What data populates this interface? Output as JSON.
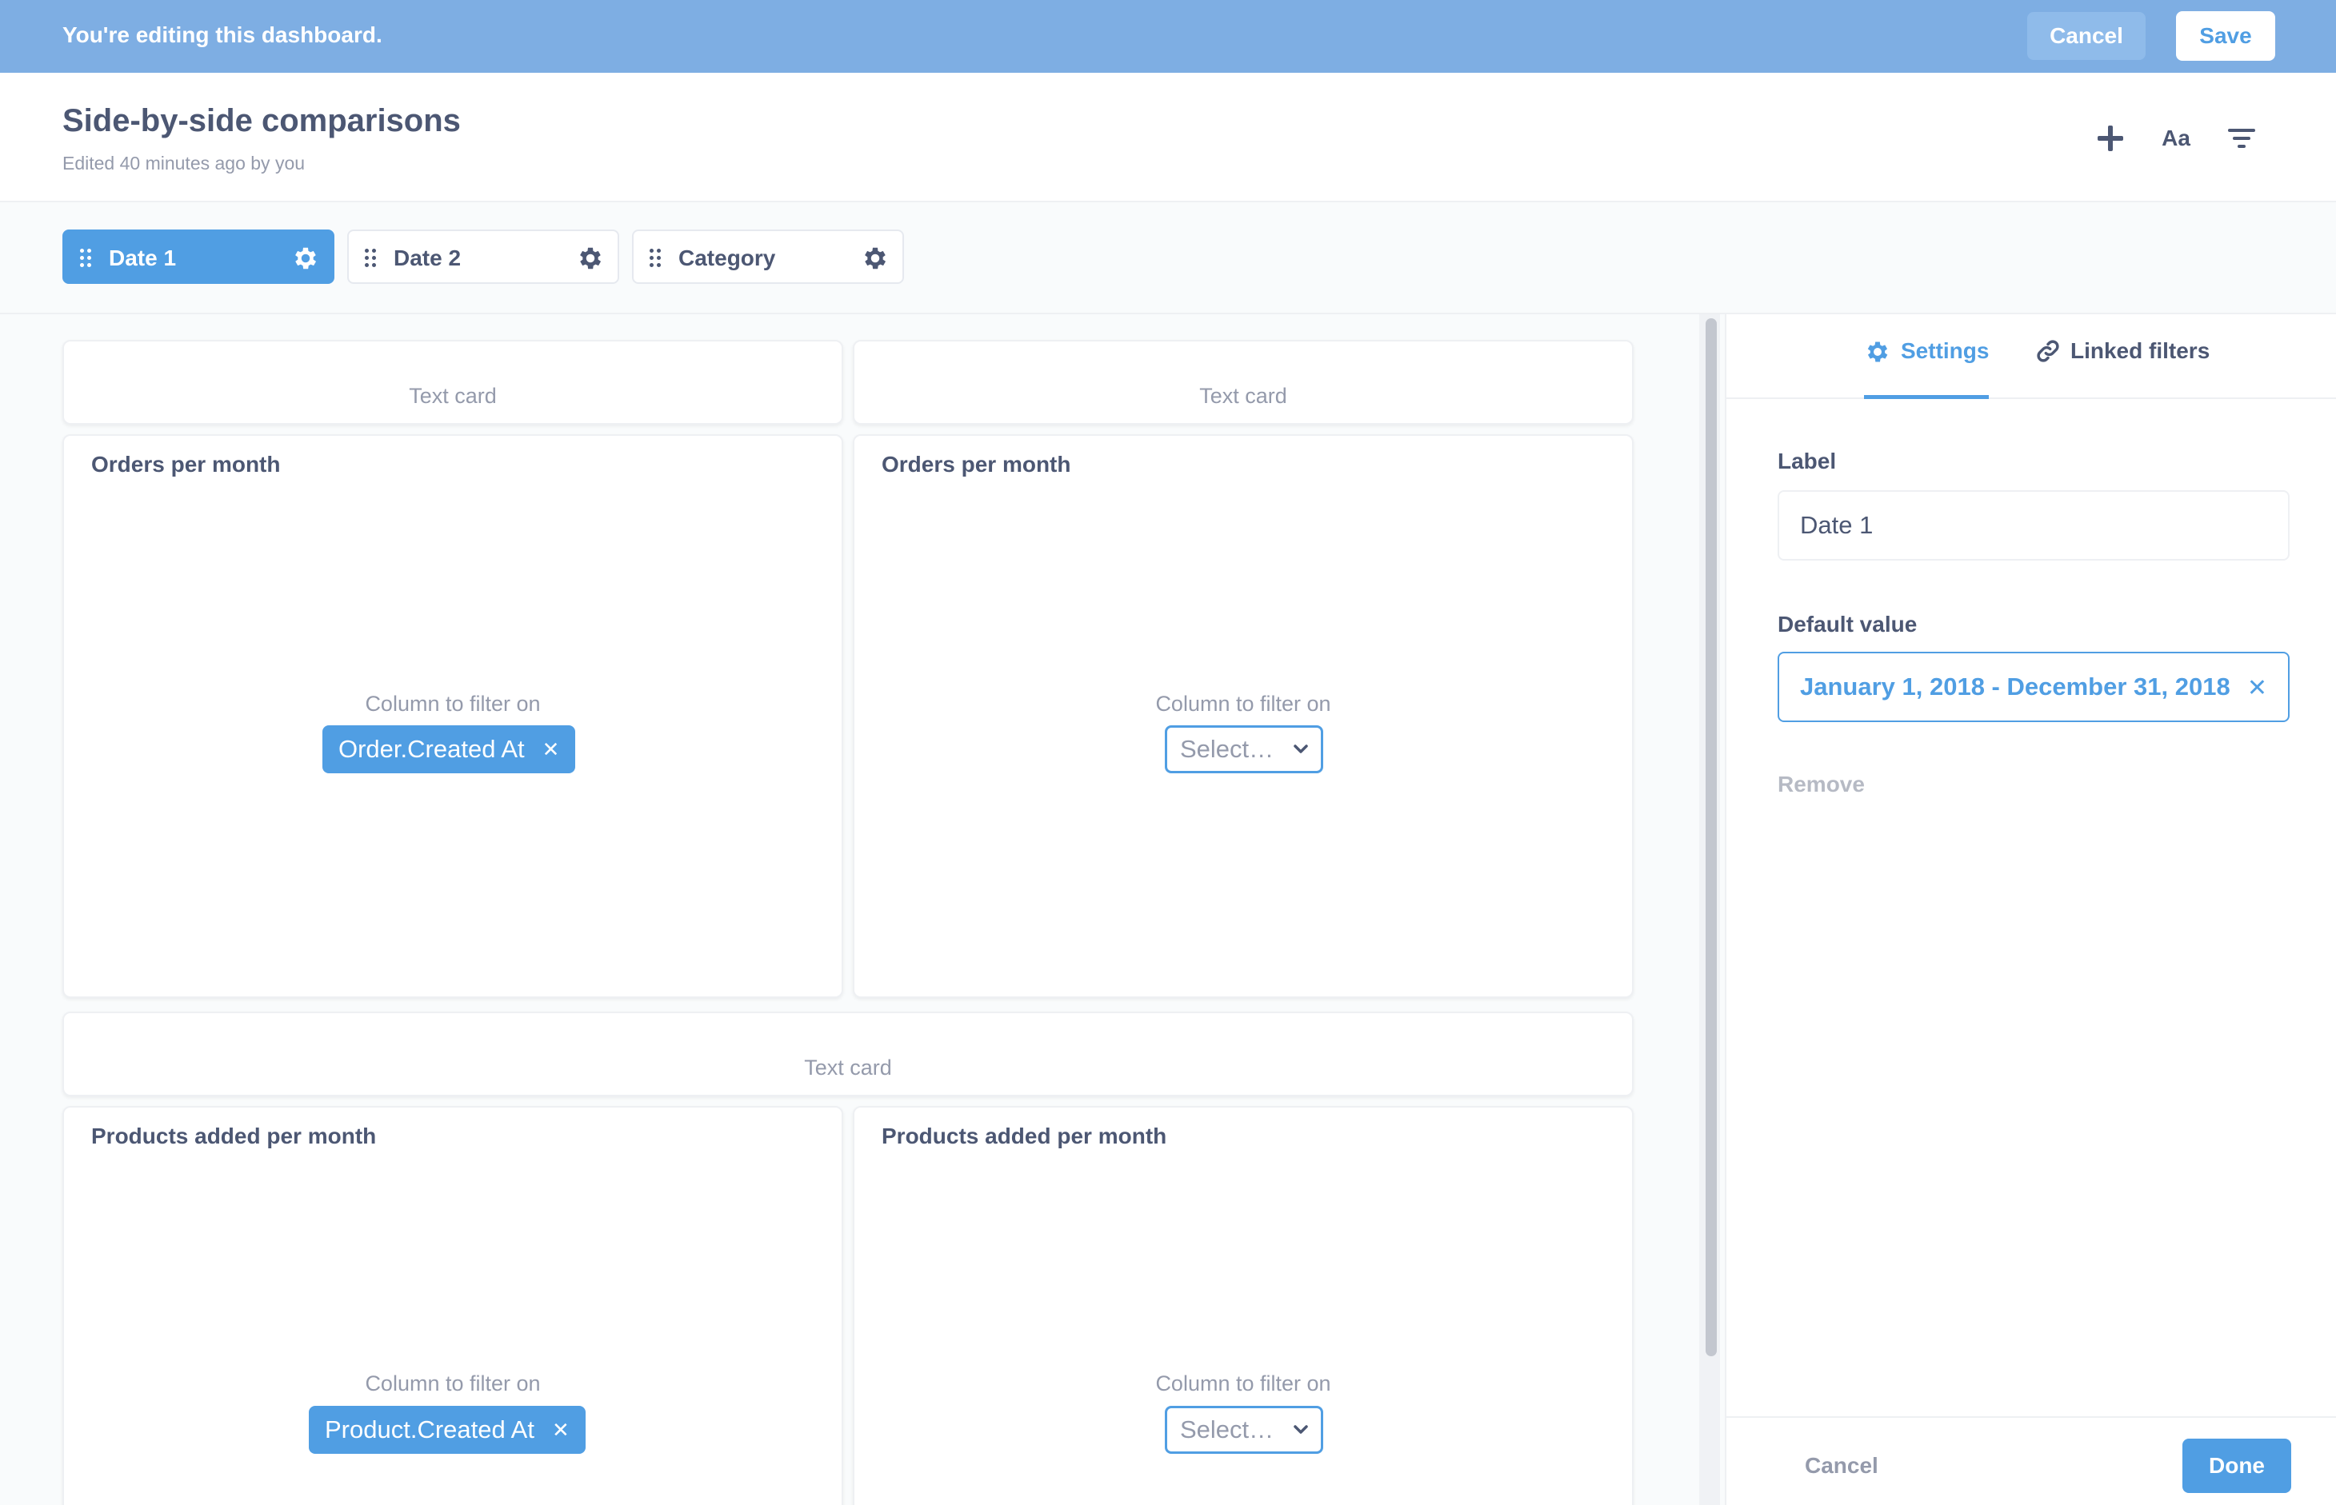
{
  "edit_bar": {
    "message": "You're editing this dashboard.",
    "cancel_label": "Cancel",
    "save_label": "Save"
  },
  "header": {
    "title": "Side-by-side comparisons",
    "subtitle": "Edited 40 minutes ago by you",
    "icons": [
      "add-icon",
      "text-format-icon",
      "filter-icon"
    ],
    "text_icon_label": "Aa"
  },
  "filters": [
    {
      "label": "Date 1",
      "active": true
    },
    {
      "label": "Date 2",
      "active": false
    },
    {
      "label": "Category",
      "active": false
    }
  ],
  "cards": {
    "text_card_label": "Text card",
    "column_to_filter_label": "Column to filter on",
    "orders_title": "Orders per month",
    "products_title": "Products added per month",
    "orders_mapped": "Order.Created At",
    "products_mapped": "Product.Created At",
    "select_placeholder": "Select…"
  },
  "sidebar": {
    "tabs": [
      {
        "label": "Settings",
        "icon": "gear-icon",
        "active": true
      },
      {
        "label": "Linked filters",
        "icon": "link-icon",
        "active": false
      }
    ],
    "label_field_label": "Label",
    "label_value": "Date 1",
    "default_value_label": "Default value",
    "default_value": "January 1, 2018 - December 31, 2018",
    "remove_label": "Remove",
    "cancel_label": "Cancel",
    "done_label": "Done"
  },
  "colors": {
    "brand": "#509ee3",
    "edit_bar": "#7eaee3",
    "text_dark": "#4c5773",
    "text_light": "#949aab"
  }
}
